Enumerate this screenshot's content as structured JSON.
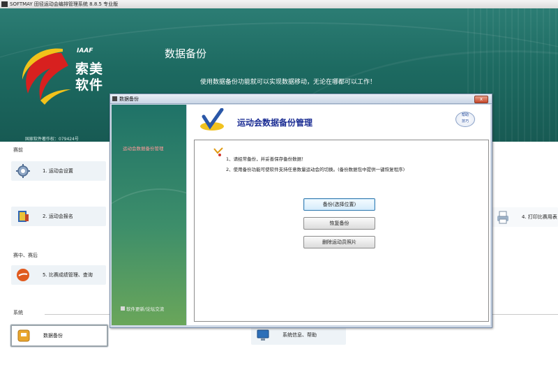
{
  "window": {
    "title": "SOFTMAY 田径运动会编排管理系统 8.8.5  专业版"
  },
  "banner": {
    "logo_iaaf": "IAAF",
    "logo_brand_line1": "索美",
    "logo_brand_line2": "软件",
    "title": "数据备份",
    "subtitle": "使用数据备份功能就可以实现数据移动，无论在哪都可以工作！",
    "copyright": "国家软件著作权：079424号"
  },
  "sections": {
    "before": "赛前",
    "during_after": "赛中、赛后",
    "system": "系统"
  },
  "menu": {
    "setup": "1. 运动会设置",
    "signup": "2. 运动会报名",
    "results": "5. 比赛成绩管理、查询",
    "print": "4. 打印比赛用表",
    "backup": "数据备份",
    "sysinfo": "系统信息、帮助"
  },
  "dialog": {
    "title": "数据备份",
    "close": "x",
    "nav_link": "运动会数据备份管理",
    "footer_link": "软件更新/论坛交流",
    "header": "运动会数据备份管理",
    "help_badge_1": "帮助",
    "help_badge_2": "技巧",
    "tip1": "1、请经常备份，并妥善保存备份数据！",
    "tip2": "2、使用备份功能可使软件支持任意数量运动会的切换。(备份数据包中提供一键恢复程序)",
    "buttons": {
      "backup": "备份(选择位置)",
      "restore": "恢复备份",
      "delete_photos": "删除运动员照片"
    }
  },
  "colors": {
    "banner": "#1d6a61",
    "dialog_title": "#1a2c93",
    "nav_link": "#ff9a9a"
  }
}
